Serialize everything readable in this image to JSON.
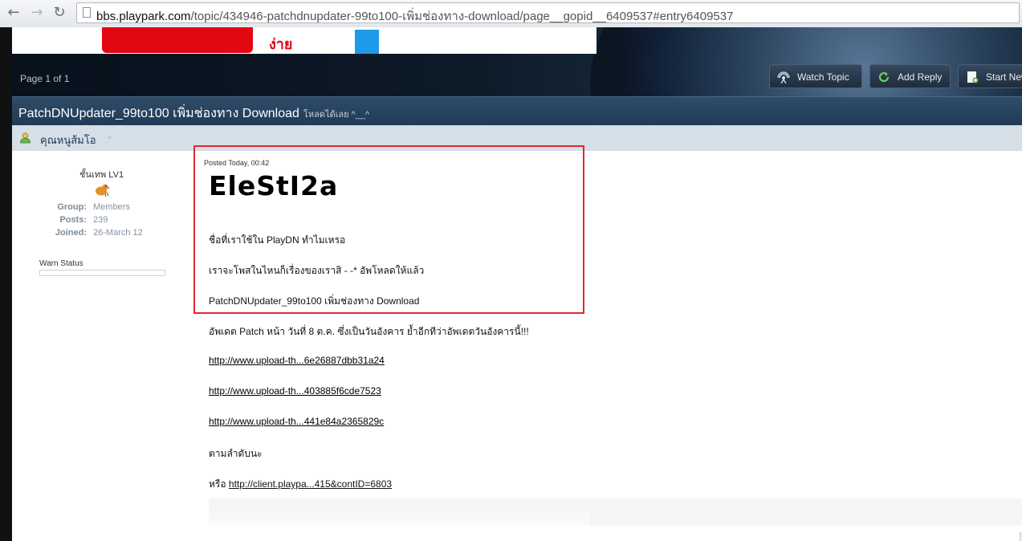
{
  "browser": {
    "url_host": "bbs.playpark.com",
    "url_path": "/topic/434946-patchdnupdater-99to100-เพิ่มช่องทาง-download/page__gopid__6409537#entry6409537",
    "back_glyph": "←",
    "forward_glyph": "→",
    "reload_glyph": "↻"
  },
  "header": {
    "banner_text": "ง่าย",
    "page_info": "Page 1 of 1",
    "buttons": {
      "watch": "Watch Topic",
      "reply": "Add Reply",
      "new": "Start New"
    }
  },
  "topic": {
    "title": "PatchDNUpdater_99to100 เพิ่มช่องทาง Download",
    "description": "โหลดได้เลย ^__^"
  },
  "author": {
    "name": "คุณหนูส้มโอ",
    "link_glyph": "▫",
    "rank": "ชั้นเทพ LV1",
    "group_label": "Group:",
    "group": "Members",
    "posts_label": "Posts:",
    "posts": "239",
    "joined_label": "Joined:",
    "joined": "26-March 12",
    "warn_status": "Warn Status"
  },
  "post": {
    "posted": "Posted Today, 00:42",
    "signature_name": "EleStI2a",
    "line1": "ชื่อที่เราใช้ใน PlayDN ทำไมเหรอ",
    "line2": "เราจะโพสในไหนก็เรื่องของเราสิ - -* อัพโหลดให้แล้ว",
    "line3": "PatchDNUpdater_99to100 เพิ่มช่องทาง Download",
    "line4": "อัพเดต Patch หน้า วันที่ 8 ต.ค. ซึ่งเป็นวันอังคาร ย้ำอีกทีว่าอัพเดตวันอังคารนี้!!!",
    "link1": "http://www.upload-th...6e26887dbb31a24",
    "link2": "http://www.upload-th...403885f6cde7523",
    "link3": "http://www.upload-th...441e84a2365829c",
    "line5": "ตามลำดับนะ",
    "or_label": "หรือ",
    "link4": "http://client.playpa...415&contID=6803"
  },
  "colors": {
    "highlight": "#e3282d",
    "topic_bar": "#2f4c69",
    "author_bar": "#d5dfe8"
  }
}
